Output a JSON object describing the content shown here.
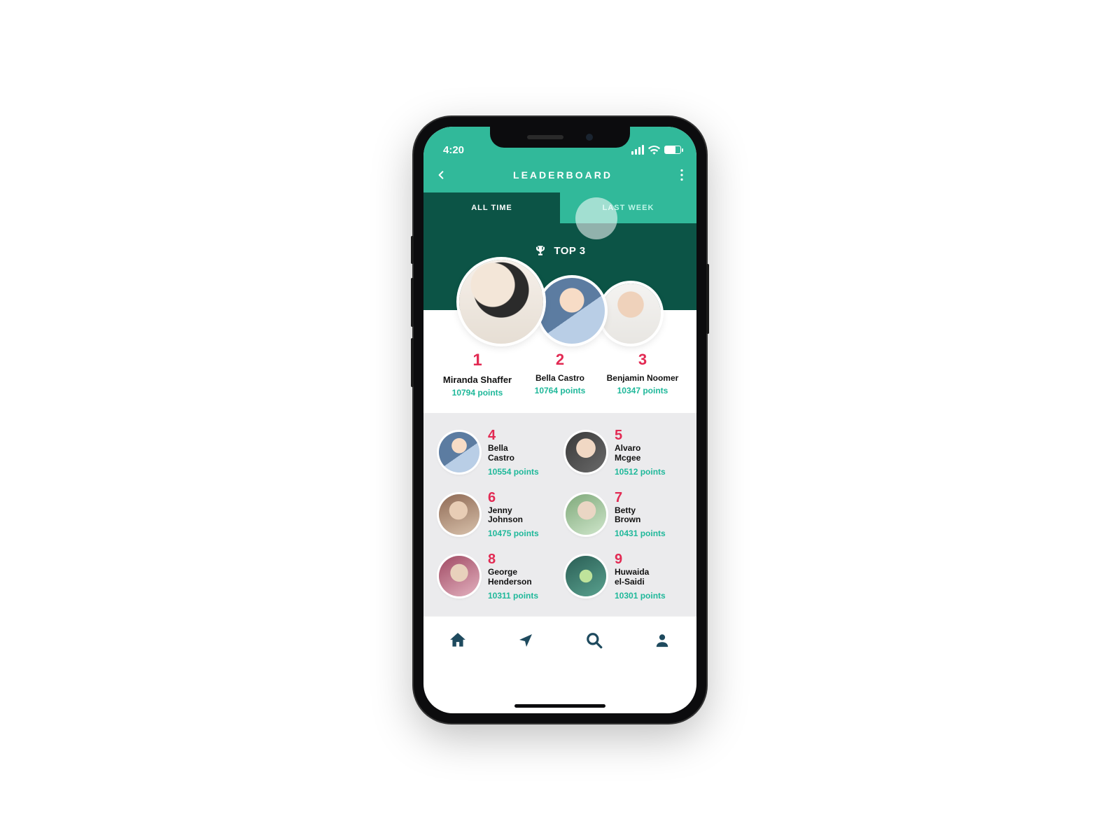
{
  "status": {
    "time": "4:20"
  },
  "header": {
    "title": "LEADERBOARD"
  },
  "tabs": {
    "all_time": "ALL TIME",
    "last_week": "LAST WEEK"
  },
  "top3_label": "TOP 3",
  "top3": [
    {
      "rank": "1",
      "name": "Miranda Shaffer",
      "points": "10794 points"
    },
    {
      "rank": "2",
      "name": "Bella Castro",
      "points": "10764 points"
    },
    {
      "rank": "3",
      "name": "Benjamin Noomer",
      "points": "10347 points"
    }
  ],
  "list": [
    {
      "rank": "4",
      "name": "Bella Castro",
      "points": "10554 points"
    },
    {
      "rank": "5",
      "name": "Alvaro Mcgee",
      "points": "10512 points"
    },
    {
      "rank": "6",
      "name": "Jenny Johnson",
      "points": "10475 points"
    },
    {
      "rank": "7",
      "name": "Betty Brown",
      "points": "10431 points"
    },
    {
      "rank": "8",
      "name": "George Henderson",
      "points": "10311 points"
    },
    {
      "rank": "9",
      "name": "Huwaida el-Saidi",
      "points": "10301 points"
    }
  ]
}
